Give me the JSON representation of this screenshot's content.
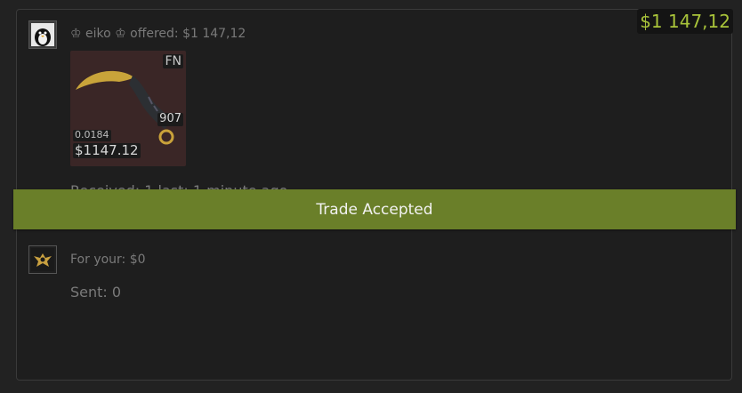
{
  "trade": {
    "total": "$1 147,12",
    "offer_text": "♔ eiko ♔ offered: $1 147,12",
    "received_text": "Received: 1 last: 1 minute ago",
    "banner": "Trade Accepted",
    "for_your": "For your: $0",
    "sent": "Sent: 0"
  },
  "item": {
    "wear": "FN",
    "stickers": "907",
    "float": "0.0184",
    "price": "$1147.12",
    "icon": "karambit-knife-icon"
  },
  "avatars": {
    "partner": "penguin-avatar-icon",
    "self": "emblem-avatar-icon"
  },
  "colors": {
    "accent": "#a8c33a",
    "banner": "#6a7f29"
  }
}
